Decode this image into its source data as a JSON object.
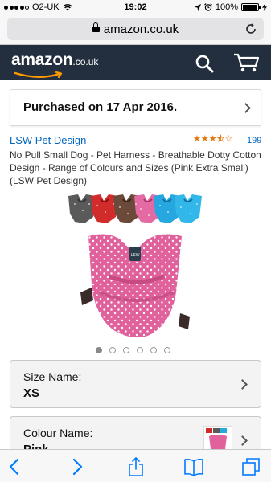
{
  "status_bar": {
    "carrier": "O2-UK",
    "time": "19:02",
    "battery": "100%",
    "battery_level": 1.0
  },
  "browser": {
    "url": "amazon.co.uk"
  },
  "header": {
    "logo_word": "amazon",
    "logo_tld": ".co.uk",
    "search_icon": "search-icon",
    "cart_icon": "cart-icon"
  },
  "purchase": {
    "text": "Purchased on 17 Apr 2016."
  },
  "product": {
    "brand": "LSW Pet Design",
    "rating_stars": 3.5,
    "rating_count": "199",
    "title": "No Pull Small Dog - Pet Harness - Breathable Dotty Cotton Design - Range of Colours and Sizes (Pink Extra Small) (LSW Pet Design)",
    "image_count": 6,
    "active_image_index": 0
  },
  "options": {
    "size_label": "Size Name:",
    "size_value": "XS",
    "colour_label": "Colour Name:",
    "colour_value": "Pink"
  },
  "colors": {
    "amazon_header": "#232f3e",
    "amazon_orange": "#ff9900",
    "link_blue": "#0066c0",
    "ios_blue": "#007aff",
    "harness_pink": "#e0619b"
  }
}
